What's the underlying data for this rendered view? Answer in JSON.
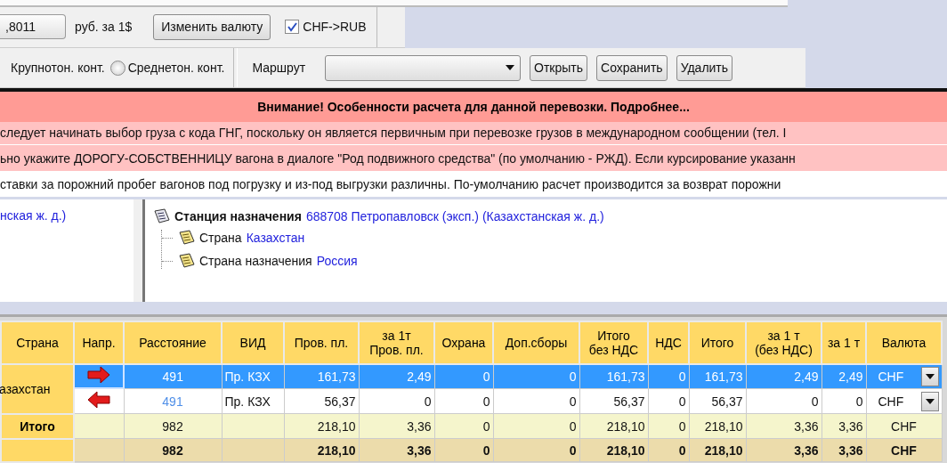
{
  "currency_bar": {
    "rate": ",8011",
    "unit": "руб.  за 1$",
    "change_button": "Изменить валюту",
    "conversion": {
      "label": "CHF->RUB",
      "checked": true
    }
  },
  "route_bar": {
    "container_label": "Крупнотон. конт.",
    "radio": {
      "label": "Среднетон. конт.",
      "selected": false
    },
    "route_label": "Маршрут",
    "buttons": [
      "Открыть",
      "Сохранить",
      "Удалить"
    ]
  },
  "notice": {
    "title": "Внимание! Особенности расчета для данной перевозки. Подробнее...",
    "lines": [
      {
        "text": " следует начинать выбор груза с кода ГНГ, поскольку он является первичным при перевозке грузов в международном сообщении (тел. I",
        "highlighted": true
      },
      {
        "text": "ьно укажите ДОРОГУ-СОБСТВЕННИЦУ вагона в диалоге \"Род подвижного средства\" (по умолчанию - РЖД).  Если курсирование указанн",
        "highlighted": true
      },
      {
        "text": "ставки за порожний пробег вагонов под погрузку и из-под выгрузки различны. По-умолчанию расчет производится за возврат порожни",
        "highlighted": false
      }
    ]
  },
  "left_panel": {
    "text": "нская ж. д.)"
  },
  "tree": {
    "label": "Станция назначения",
    "value": "688708 Петропавловск (эксп.) (Казахстанская ж. д.)",
    "children": [
      {
        "label": "Страна",
        "value": "Казахстан"
      },
      {
        "label": "Страна назначения",
        "value": "Россия"
      }
    ]
  },
  "table": {
    "columns": [
      "Страна",
      "Напр.",
      "Расстояние",
      "ВИД",
      "Пров. пл.",
      "за 1т\nПров. пл.",
      "Охрана",
      "Доп.сборы",
      "Итого\nбез НДС",
      "НДС",
      "Итого",
      "за 1 т\n(без НДС)",
      "за 1 т",
      "Валюта"
    ],
    "rows": [
      {
        "kind": "data",
        "country": "азахстан",
        "reverse": false,
        "selected": true,
        "distance": "491",
        "vid": "Пр. КЗХ",
        "values": [
          "161,73",
          "2,49",
          "0",
          "0",
          "161,73",
          "0",
          "161,73",
          "2,49",
          "2,49"
        ],
        "currency": "CHF"
      },
      {
        "kind": "data",
        "reverse": true,
        "selected": false,
        "distance": "491",
        "vid": "Пр. КЗХ",
        "values": [
          "56,37",
          "0",
          "0",
          "0",
          "56,37",
          "0",
          "56,37",
          "0",
          "0"
        ],
        "currency": "CHF"
      },
      {
        "kind": "total",
        "label": "Итого",
        "distance": "982",
        "values": [
          "218,10",
          "3,36",
          "0",
          "0",
          "218,10",
          "0",
          "218,10",
          "3,36",
          "3,36"
        ],
        "currency": "CHF"
      },
      {
        "kind": "grand_total",
        "distance": "982",
        "values": [
          "218,10",
          "3,36",
          "0",
          "0",
          "218,10",
          "0",
          "218,10",
          "3,36",
          "3,36"
        ],
        "currency": "CHF"
      }
    ]
  }
}
